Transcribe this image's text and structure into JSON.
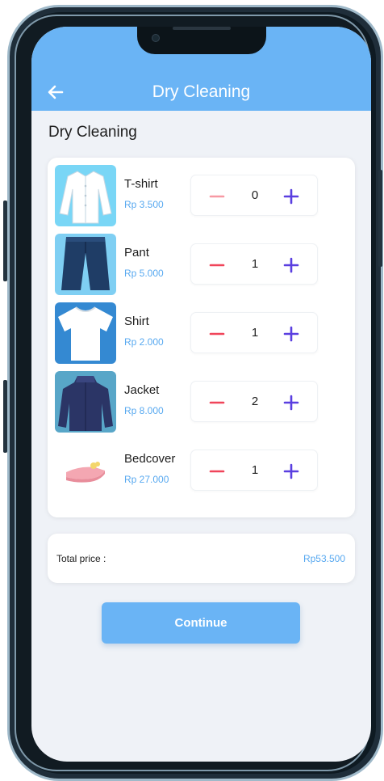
{
  "appbar": {
    "title": "Dry Cleaning"
  },
  "page": {
    "title": "Dry Cleaning"
  },
  "items": [
    {
      "name": "T-shirt",
      "price": "Rp 3.500",
      "qty": "0",
      "icon": "tshirt-icon"
    },
    {
      "name": "Pant",
      "price": "Rp 5.000",
      "qty": "1",
      "icon": "pant-icon"
    },
    {
      "name": "Shirt",
      "price": "Rp 2.000",
      "qty": "1",
      "icon": "shirt-icon"
    },
    {
      "name": "Jacket",
      "price": "Rp 8.000",
      "qty": "2",
      "icon": "jacket-icon"
    },
    {
      "name": "Bedcover",
      "price": "Rp 27.000",
      "qty": "1",
      "icon": "bedcover-icon"
    }
  ],
  "total": {
    "label": "Total price :",
    "value": "Rp53.500"
  },
  "actions": {
    "continue_label": "Continue"
  },
  "colors": {
    "primary": "#6ab4f5",
    "price": "#58a9f0",
    "minus": "#f0455a",
    "plus": "#5a3fe0",
    "background": "#eff2f7"
  }
}
